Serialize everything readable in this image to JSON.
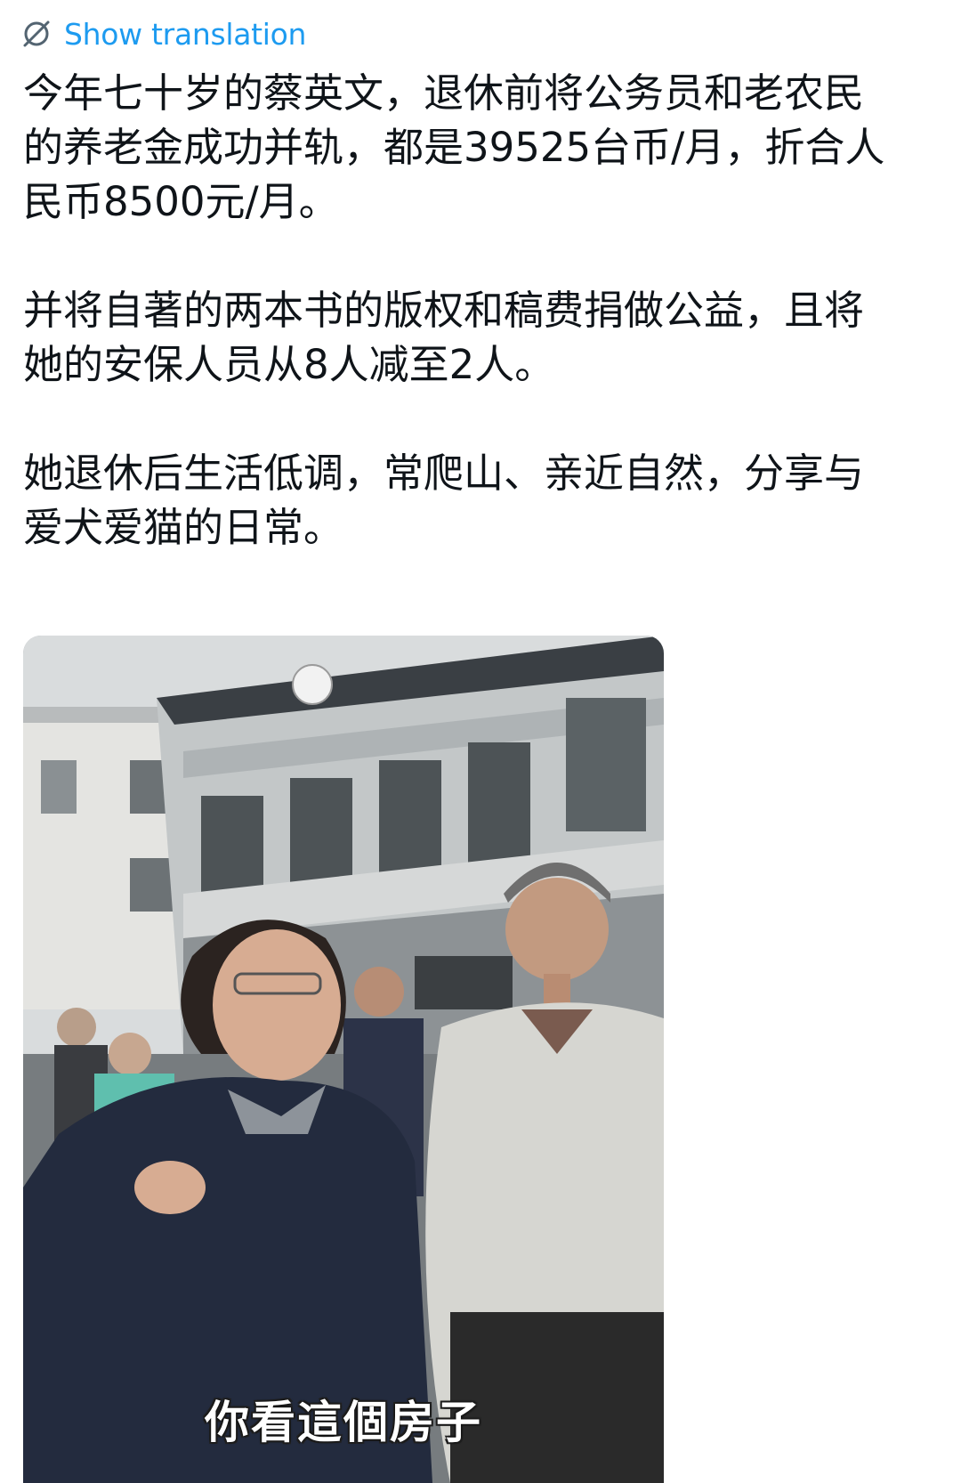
{
  "translate": {
    "icon": "globe-slash-icon",
    "label": "Show translation"
  },
  "post": {
    "paragraphs": [
      "今年七十岁的蔡英文，退休前将公务员和老农民\n的养老金成功并轨，都是39525台币/月，折合人\n民币8500元/月。",
      "并将自著的两本书的版权和稿费捐做公益，且将\n她的安保人员从8人减至2人。",
      "她退休后生活低调，常爬山、亲近自然，分享与\n爱犬爱猫的日常。"
    ]
  },
  "media": {
    "subtitle": "你看這個房子",
    "colors": {
      "sky": "#d9dcdd",
      "building": "#c7cacb",
      "jacket_dark": "#222a3c",
      "jacket_light": "#d8d8d4"
    }
  }
}
